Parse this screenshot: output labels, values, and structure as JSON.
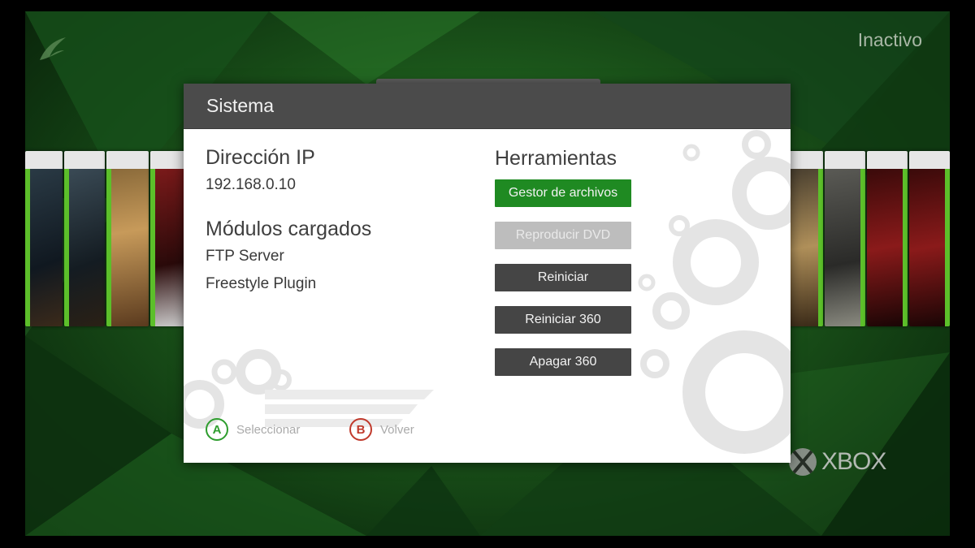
{
  "status": {
    "text": "Inactivo"
  },
  "brand": {
    "text": "XBOX"
  },
  "dialog": {
    "title": "Sistema",
    "ip": {
      "heading": "Dirección IP",
      "value": "192.168.0.10"
    },
    "modules": {
      "heading": "Módulos cargados",
      "items": [
        "FTP Server",
        "Freestyle Plugin"
      ]
    },
    "tools": {
      "heading": "Herramientas",
      "buttons": [
        {
          "label": "Gestor de archivos",
          "state": "selected"
        },
        {
          "label": "Reproducir DVD",
          "state": "disabled"
        },
        {
          "label": "Reiniciar",
          "state": "normal"
        },
        {
          "label": "Reiniciar 360",
          "state": "normal"
        },
        {
          "label": "Apagar 360",
          "state": "normal"
        }
      ]
    },
    "hints": [
      {
        "key": "A",
        "label": "Seleccionar",
        "color": "#2e9d2e"
      },
      {
        "key": "B",
        "label": "Volver",
        "color": "#c0392b"
      }
    ]
  },
  "colors": {
    "accent": "#1f8a22",
    "header": "#4b4b4b",
    "background": "#1d5a1c"
  }
}
